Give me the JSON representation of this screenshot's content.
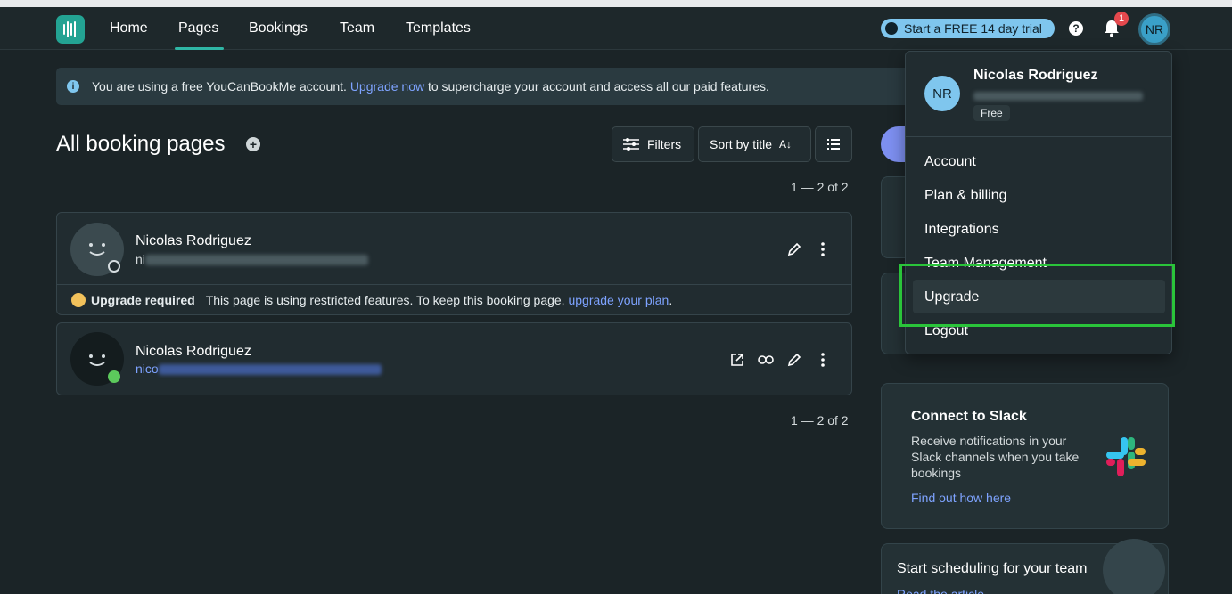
{
  "nav": {
    "links": [
      "Home",
      "Pages",
      "Bookings",
      "Team",
      "Templates"
    ],
    "trial_label": "Start a FREE 14 day trial",
    "notification_count": "1",
    "avatar_initials": "NR"
  },
  "banner": {
    "text_before": "You are using a free YouCanBookMe account.",
    "link": "Upgrade now",
    "text_after": "to supercharge your account and access all our paid features."
  },
  "main": {
    "title": "All booking pages",
    "filters_label": "Filters",
    "sort_label": "Sort by title",
    "count_top": "1 — 2 of 2",
    "count_bottom": "1 — 2 of 2",
    "pages": [
      {
        "name": "Nicolas Rodriguez",
        "email_prefix": "ni"
      },
      {
        "name": "Nicolas Rodriguez",
        "email_prefix": "nico"
      }
    ],
    "warning": {
      "title": "Upgrade required",
      "text": "This page is using restricted features. To keep this booking page,",
      "link": "upgrade your plan",
      "end": "."
    }
  },
  "side": {
    "slack_title": "Connect to Slack",
    "slack_text": "Receive notifications in your Slack channels when you take bookings",
    "slack_link": "Find out how here",
    "team_title": "Start scheduling for your team",
    "team_link": "Read the article"
  },
  "dropdown": {
    "name": "Nicolas Rodriguez",
    "initials": "NR",
    "plan": "Free",
    "items": [
      "Account",
      "Plan & billing",
      "Integrations",
      "Team Management",
      "Upgrade",
      "Logout"
    ]
  },
  "colors": {
    "accent": "#2fb6a5",
    "link": "#7ea3ff",
    "highlight": "#2ac43a"
  }
}
